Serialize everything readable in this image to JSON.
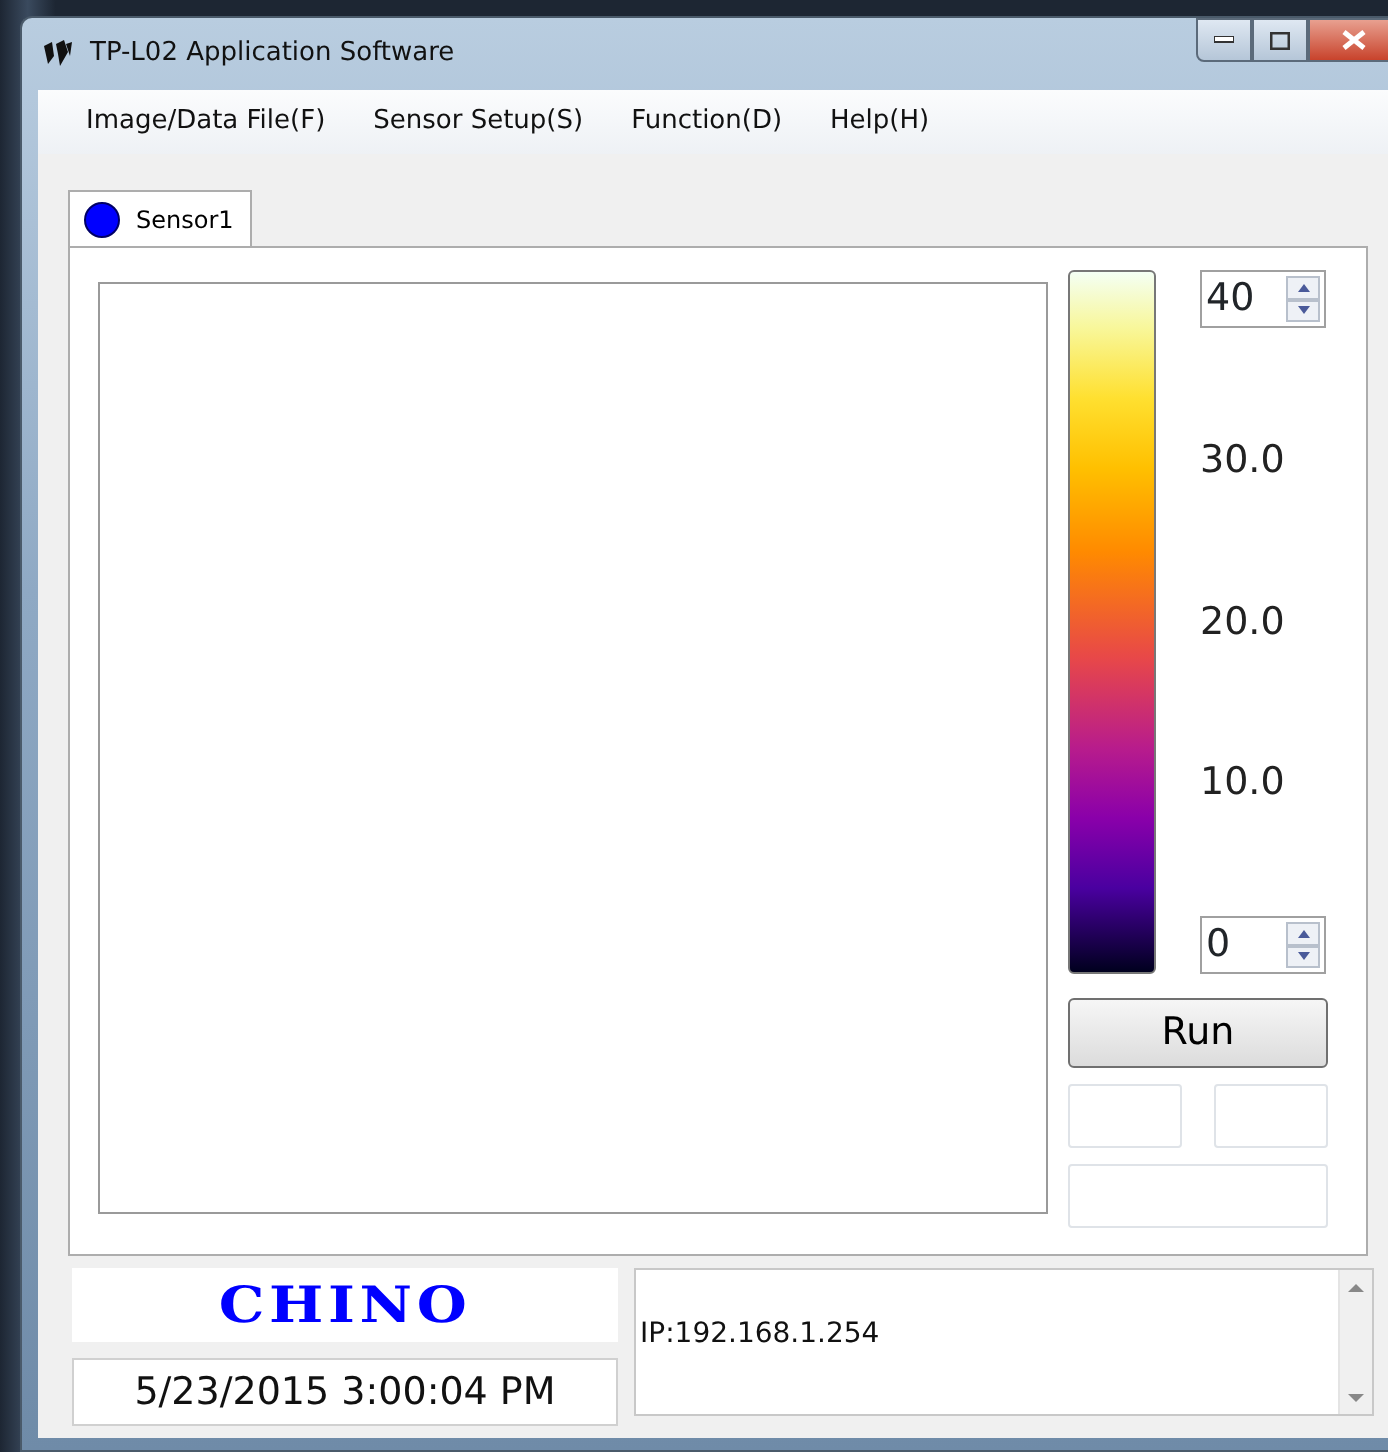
{
  "window": {
    "title": "TP-L02 Application Software"
  },
  "menu": [
    "Image/Data File(F)",
    "Sensor Setup(S)",
    "Function(D)",
    "Help(H)"
  ],
  "tabs": [
    {
      "label": "Sensor1",
      "selected": true
    }
  ],
  "scale": {
    "max": "40",
    "labels": [
      "30.0",
      "20.0",
      "10.0"
    ],
    "min": "0"
  },
  "run_button": "Run",
  "logo": "CHINO",
  "datetime": "5/23/2015 3:00:04 PM",
  "log": "IP:192.168.1.254"
}
